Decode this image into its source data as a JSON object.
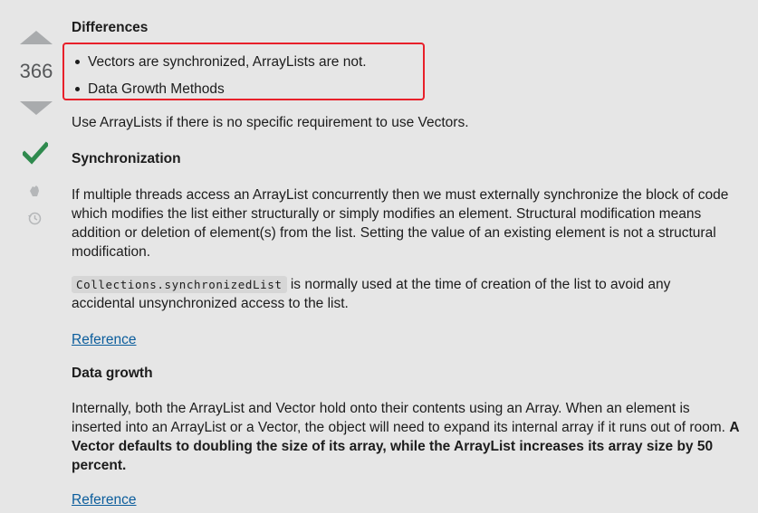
{
  "vote": {
    "score": "366",
    "accepted": true
  },
  "icons": {
    "upvote": "triangle-up-icon",
    "downvote": "triangle-down-icon",
    "accepted": "checkmark-icon",
    "reward": "hand-icon",
    "history": "history-clock-icon"
  },
  "colors": {
    "accepted_green": "#2f8a4e",
    "highlight_box": "#e8202a",
    "link": "#0b5d9c"
  },
  "answer": {
    "differences_heading": "Differences",
    "differences_items": [
      "Vectors are synchronized, ArrayLists are not.",
      "Data Growth Methods"
    ],
    "use_note": "Use ArrayLists if there is no specific requirement to use Vectors.",
    "sync_heading": "Synchronization",
    "sync_paragraph": "If multiple threads access an ArrayList concurrently then we must externally synchronize the block of code which modifies the list either structurally or simply modifies an element. Structural modification means addition or deletion of element(s) from the list. Setting the value of an existing element is not a structural modification.",
    "collections_code": "Collections.synchronizedList",
    "collections_text": " is normally used at the time of creation of the list to avoid any accidental unsynchronized access to the list.",
    "reference_1": "Reference",
    "growth_heading": "Data growth",
    "growth_paragraph": "Internally, both the ArrayList and Vector hold onto their contents using an Array. When an element is inserted into an ArrayList or a Vector, the object will need to expand its internal array if it runs out of room. ",
    "growth_bold": "A Vector defaults to doubling the size of its array, while the ArrayList increases its array size by 50 percent.",
    "reference_2": "Reference"
  }
}
